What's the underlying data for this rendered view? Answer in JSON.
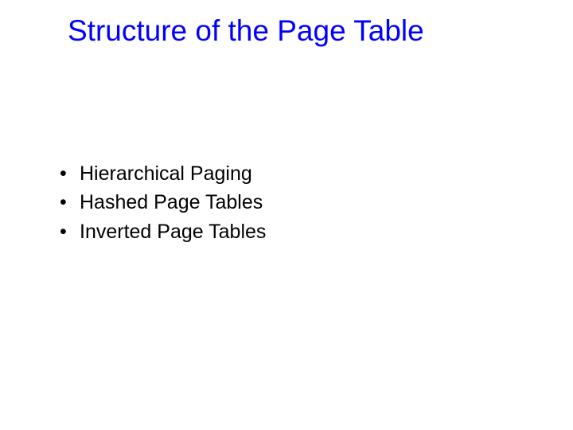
{
  "title": "Structure of the Page Table",
  "bullets": [
    "Hierarchical Paging",
    "Hashed Page Tables",
    "Inverted Page Tables"
  ]
}
